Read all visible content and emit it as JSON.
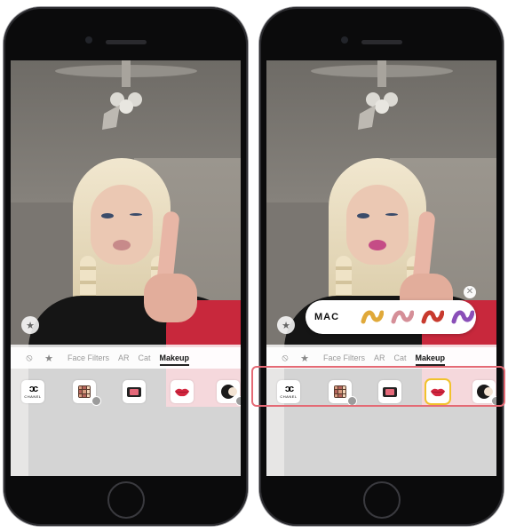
{
  "phones": [
    {
      "id": "left",
      "tabs": {
        "face_filters": "Face Filters",
        "ar": "AR",
        "cat": "Cat",
        "makeup": "Makeup"
      },
      "active_tab": "Makeup",
      "brand_tiles": [
        {
          "name": "Chanel",
          "icon": "chanel-logo",
          "label": "CHANEL",
          "selected": false
        },
        {
          "name": "Eyeshadow palette",
          "icon": "eyeshadow-palette-icon",
          "selected": false
        },
        {
          "name": "Blush",
          "icon": "blush-compact-icon",
          "selected": false
        },
        {
          "name": "Lipstick",
          "icon": "lips-icon",
          "selected": false
        },
        {
          "name": "Compact",
          "icon": "compact-icon",
          "selected": false
        }
      ]
    },
    {
      "id": "right",
      "tabs": {
        "face_filters": "Face Filters",
        "ar": "AR",
        "cat": "Cat",
        "makeup": "Makeup"
      },
      "active_tab": "Makeup",
      "brand_tiles": [
        {
          "name": "Chanel",
          "icon": "chanel-logo",
          "label": "CHANEL",
          "selected": false
        },
        {
          "name": "Eyeshadow palette",
          "icon": "eyeshadow-palette-icon",
          "selected": false
        },
        {
          "name": "Blush",
          "icon": "blush-compact-icon",
          "selected": false
        },
        {
          "name": "Lipstick",
          "icon": "lips-icon",
          "selected": true
        },
        {
          "name": "Compact",
          "icon": "compact-icon",
          "selected": false
        }
      ],
      "shade_picker": {
        "brand": "MAC",
        "shades": [
          "#e0a93a",
          "#d58f98",
          "#c83a2e",
          "#8a4fb8"
        ]
      }
    }
  ],
  "colors": {
    "highlight_border": "#e46a75",
    "selected_tile": "#f1c22c",
    "lip_red": "#d3263f"
  }
}
